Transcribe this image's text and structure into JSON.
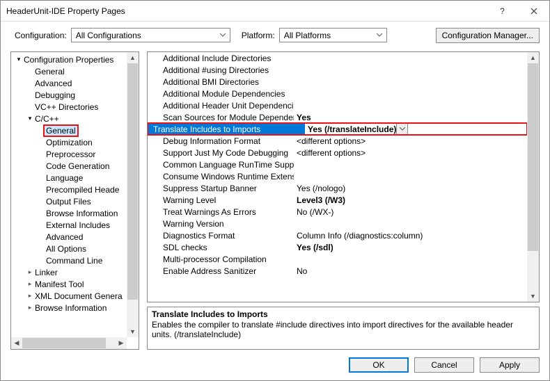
{
  "title": "HeaderUnit-IDE Property Pages",
  "cfg": {
    "configurationLabel": "Configuration:",
    "configurationValue": "All Configurations",
    "platformLabel": "Platform:",
    "platformValue": "All Platforms",
    "managerLabel": "Configuration Manager..."
  },
  "tree": {
    "root": "Configuration Properties",
    "items": [
      "General",
      "Advanced",
      "Debugging",
      "VC++ Directories"
    ],
    "ccpp": "C/C++",
    "ccppItems": [
      "General",
      "Optimization",
      "Preprocessor",
      "Code Generation",
      "Language",
      "Precompiled Heade",
      "Output Files",
      "Browse Information",
      "External Includes",
      "Advanced",
      "All Options",
      "Command Line"
    ],
    "after": [
      "Linker",
      "Manifest Tool",
      "XML Document Genera",
      "Browse Information"
    ]
  },
  "rows": [
    {
      "k": "Additional Include Directories",
      "v": ""
    },
    {
      "k": "Additional #using Directories",
      "v": ""
    },
    {
      "k": "Additional BMI Directories",
      "v": ""
    },
    {
      "k": "Additional Module Dependencies",
      "v": ""
    },
    {
      "k": "Additional Header Unit Dependencies",
      "v": ""
    },
    {
      "k": "Scan Sources for Module Dependencies",
      "v": "Yes",
      "bold": true
    },
    {
      "k": "Translate Includes to Imports",
      "v": "Yes (/translateInclude)",
      "bold": true,
      "selected": true
    },
    {
      "k": "Debug Information Format",
      "v": "<different options>"
    },
    {
      "k": "Support Just My Code Debugging",
      "v": "<different options>"
    },
    {
      "k": "Common Language RunTime Support",
      "v": ""
    },
    {
      "k": "Consume Windows Runtime Extension",
      "v": ""
    },
    {
      "k": "Suppress Startup Banner",
      "v": "Yes (/nologo)"
    },
    {
      "k": "Warning Level",
      "v": "Level3 (/W3)",
      "bold": true
    },
    {
      "k": "Treat Warnings As Errors",
      "v": "No (/WX-)"
    },
    {
      "k": "Warning Version",
      "v": ""
    },
    {
      "k": "Diagnostics Format",
      "v": "Column Info (/diagnostics:column)"
    },
    {
      "k": "SDL checks",
      "v": "Yes (/sdl)",
      "bold": true
    },
    {
      "k": "Multi-processor Compilation",
      "v": ""
    },
    {
      "k": "Enable Address Sanitizer",
      "v": "No"
    }
  ],
  "desc": {
    "title": "Translate Includes to Imports",
    "body": "Enables the compiler to translate #include directives into import directives for the available header units. (/translateInclude)"
  },
  "footer": {
    "ok": "OK",
    "cancel": "Cancel",
    "apply": "Apply"
  }
}
